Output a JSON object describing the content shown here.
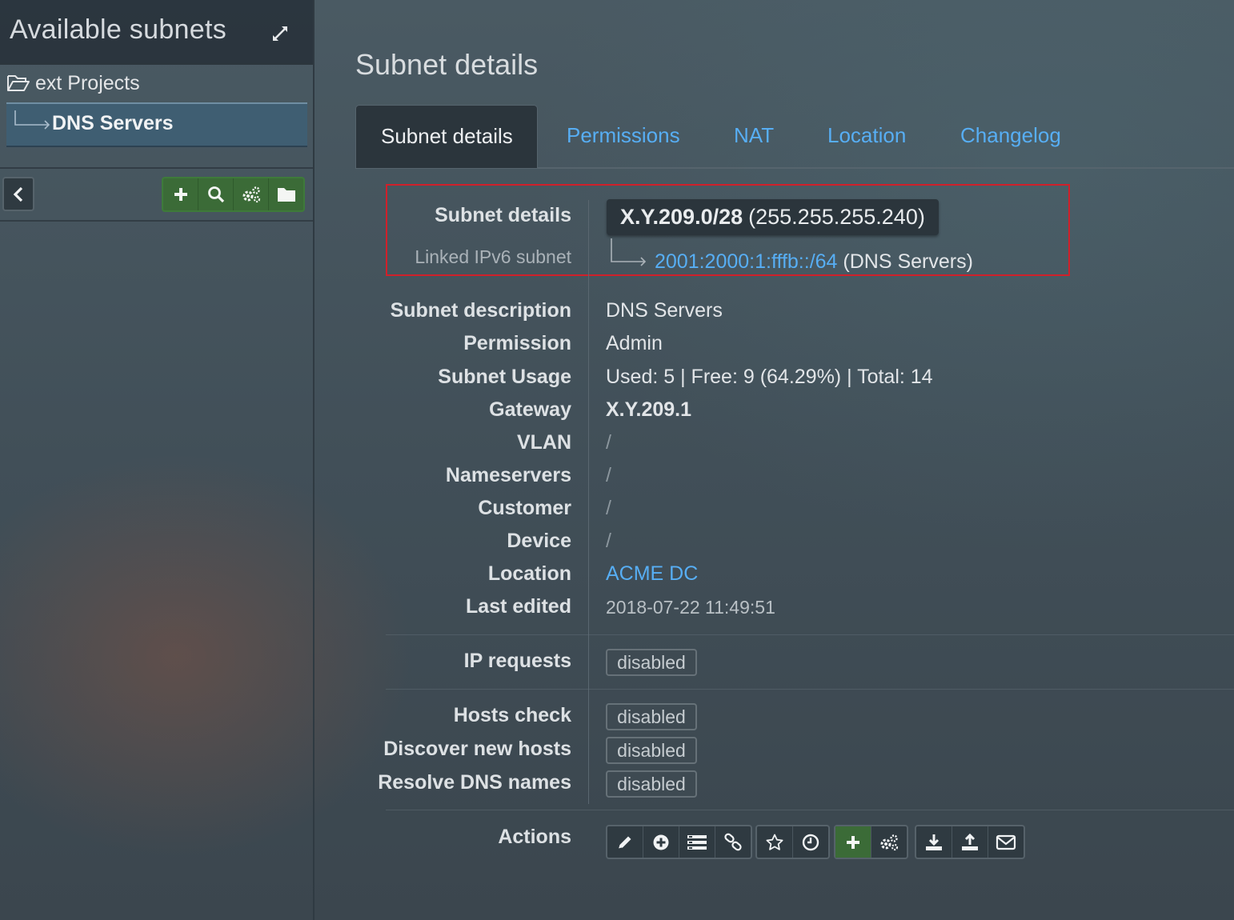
{
  "sidebar": {
    "title": "Available subnets",
    "expand_icon": "expand-arrows-icon",
    "tree": {
      "folder_label": "ext Projects",
      "folder_icon": "folder-open-icon",
      "selected_label": "DNS Servers"
    },
    "toolbar": {
      "collapse_icon": "chevron-left-icon",
      "buttons": [
        "plus-icon",
        "search-icon",
        "gears-icon",
        "folder-icon"
      ]
    }
  },
  "main": {
    "heading": "Subnet details",
    "tabs": [
      {
        "label": "Subnet details",
        "active": true
      },
      {
        "label": "Permissions"
      },
      {
        "label": "NAT"
      },
      {
        "label": "Location"
      },
      {
        "label": "Changelog"
      }
    ],
    "details": {
      "subnet_label": "Subnet details",
      "subnet_cidr": "X.Y.209.0/28",
      "subnet_mask": "(255.255.255.240)",
      "linked_label": "Linked IPv6 subnet",
      "linked_ipv6": "2001:2000:1:fffb::/64",
      "linked_name": "(DNS Servers)",
      "rows": [
        {
          "label": "Subnet description",
          "value": "DNS Servers"
        },
        {
          "label": "Permission",
          "value": "Admin"
        },
        {
          "label": "Subnet Usage",
          "value": "Used: 5 | Free: 9 (64.29%) | Total: 14"
        },
        {
          "label": "Gateway",
          "value": "X.Y.209.1"
        },
        {
          "label": "VLAN",
          "value": "/"
        },
        {
          "label": "Nameservers",
          "value": "/"
        },
        {
          "label": "Customer",
          "value": "/"
        },
        {
          "label": "Device",
          "value": "/"
        },
        {
          "label": "Location",
          "value": "ACME DC"
        },
        {
          "label": "Last edited",
          "value": "2018-07-22 11:49:51"
        }
      ],
      "ip_requests_label": "IP requests",
      "ip_requests_value": "disabled",
      "hosts_check_label": "Hosts check",
      "hosts_check_value": "disabled",
      "discover_label": "Discover new hosts",
      "discover_value": "disabled",
      "resolve_label": "Resolve DNS names",
      "resolve_value": "disabled",
      "actions_label": "Actions"
    },
    "actions": {
      "group1": [
        "pencil-icon",
        "plus-circle-icon",
        "list-icon",
        "link-icon"
      ],
      "group2": [
        "star-icon",
        "clock-icon"
      ],
      "group3": [
        "plus-icon",
        "gears-icon"
      ],
      "group4": [
        "download-icon",
        "upload-icon",
        "envelope-icon"
      ]
    },
    "colors": {
      "link": "#57aef4",
      "highlight": "#d0202a",
      "green": "#3b6b37"
    }
  }
}
